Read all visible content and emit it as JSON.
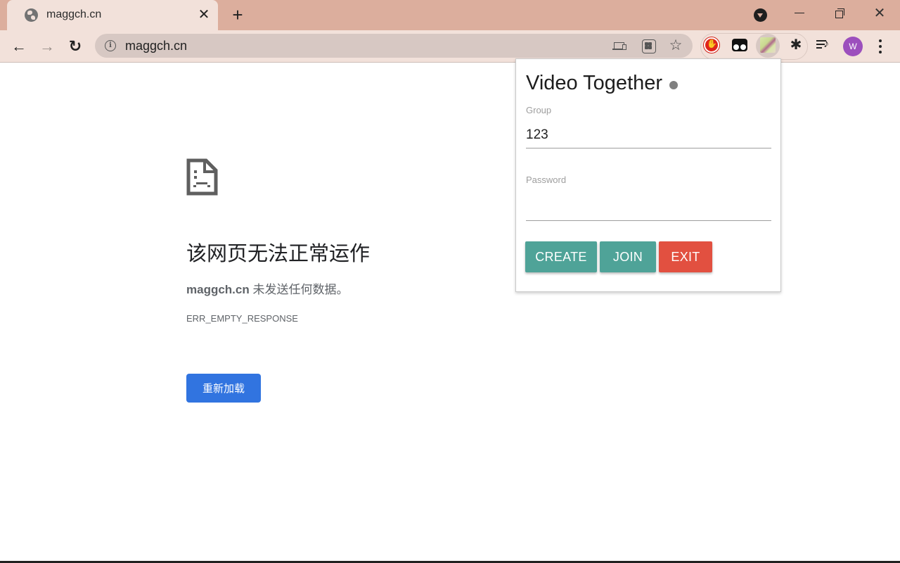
{
  "browser": {
    "tab": {
      "title": "maggch.cn",
      "favicon": "globe-icon",
      "close_glyph": "✕"
    },
    "new_tab_glyph": "+",
    "window_controls": {
      "close_glyph": "✕"
    },
    "toolbar": {
      "back_glyph": "←",
      "forward_glyph": "→",
      "reload_glyph": "↻",
      "url": "maggch.cn",
      "info_glyph": "i",
      "star_glyph": "☆",
      "extensions": [
        "ublock-origin-icon",
        "tampermonkey-icon",
        "video-together-icon",
        "extensions-puzzle-icon",
        "media-control-icon"
      ],
      "puzzle_glyph": "✱",
      "profile_initial": "W",
      "profile_color": "#9c4fbd"
    }
  },
  "error_page": {
    "title": "该网页无法正常运作",
    "host": "maggch.cn",
    "description_suffix": " 未发送任何数据。",
    "error_code": "ERR_EMPTY_RESPONSE",
    "reload_label": "重新加载",
    "reload_color": "#3174e0"
  },
  "popup": {
    "title": "Video Together",
    "status_color": "#808080",
    "group": {
      "label": "Group",
      "value": "123",
      "placeholder": ""
    },
    "password": {
      "label": "Password",
      "value": "",
      "placeholder": ""
    },
    "buttons": {
      "create": "CREATE",
      "join": "JOIN",
      "exit": "EXIT"
    },
    "colors": {
      "primary": "#4fa398",
      "danger": "#e25040"
    }
  }
}
